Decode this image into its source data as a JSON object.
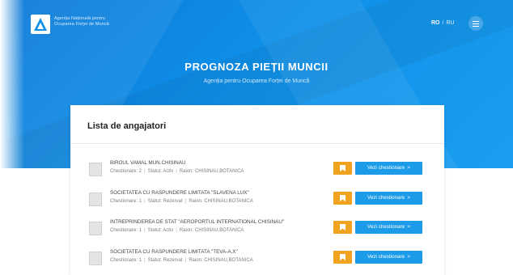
{
  "header": {
    "agency_line1": "Agenția Națională pentru",
    "agency_line2": "Ocuparea Forței de Muncă",
    "lang_active": "RO",
    "lang_sep": "/",
    "lang_other": "RU"
  },
  "hero": {
    "title": "PROGNOZA PIEȚII MUNCII",
    "subtitle": "Agenția pentru Ocuparea Forței de Muncă"
  },
  "list": {
    "title": "Lista de angajatori",
    "view_label": "Vezi chestionare",
    "view_chevron": ">",
    "rows": [
      {
        "name": "BIROUL VAMAL MUN.CHISINAU",
        "count": "Chestionare: 2",
        "status": "Statut: Activ",
        "raion": "Raion: CHISINAU,BOTANICA"
      },
      {
        "name": "SOCIETATEA CU RASPUNDERE LIMITATA \"SLAVENA LUX\"",
        "count": "Chestionare: 1",
        "status": "Statut: Rezervat",
        "raion": "Raion: CHISINAU,BOTANICA"
      },
      {
        "name": "INTREPRINDEREA DE STAT \"AEROPORTUL INTERNATIONAL CHISINAU\"",
        "count": "Chestionare: 1",
        "status": "Statut: Activ",
        "raion": "Raion: CHISINAU,BOTANICA"
      },
      {
        "name": "SOCIETATEA CU RASPUNDERE LIMITATA \"TEVA-A.X\"",
        "count": "Chestionare: 1",
        "status": "Statut: Rezervat",
        "raion": "Raion: CHISINAU,BOTANICA"
      }
    ]
  },
  "colors": {
    "hero_blue": "#0f8fe8",
    "bookmark_orange": "#f0a31e",
    "button_blue": "#1c9be8"
  },
  "icons": {
    "logo": "agency-logo",
    "menu": "hamburger-menu-icon",
    "bookmark": "bookmark-icon",
    "row_thumb": "placeholder-image-icon"
  }
}
